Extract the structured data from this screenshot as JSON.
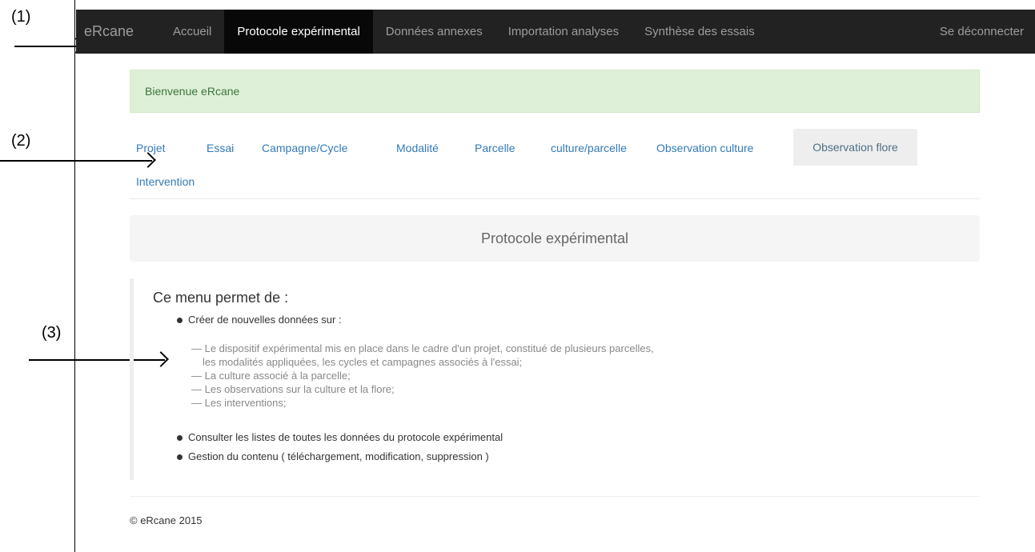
{
  "annotations": {
    "label_1": "(1)",
    "label_2": "(2)",
    "label_3": "(3)"
  },
  "navbar": {
    "brand": "eRcane",
    "items": [
      {
        "label": "Accueil",
        "active": false
      },
      {
        "label": "Protocole expérimental",
        "active": true
      },
      {
        "label": "Données annexes",
        "active": false
      },
      {
        "label": "Importation analyses",
        "active": false
      },
      {
        "label": "Synthèse des essais",
        "active": false
      }
    ],
    "logout": "Se déconnecter"
  },
  "alert": {
    "text": "Bienvenue eRcane"
  },
  "tabs": [
    {
      "label": "Projet"
    },
    {
      "label": "Essai"
    },
    {
      "label": "Campagne/Cycle"
    },
    {
      "label": "Modalité"
    },
    {
      "label": "Parcelle"
    },
    {
      "label": "culture/parcelle"
    },
    {
      "label": "Observation culture"
    },
    {
      "label": "Observation flore",
      "active": true
    },
    {
      "label": "Intervention"
    }
  ],
  "main": {
    "title": "Protocole expérimental",
    "menu_title": "Ce menu permet de :",
    "item_1": "Créer de nouvelles données sur :",
    "sub_1a": "— Le dispositif expérimental mis en place dans le cadre d'un projet, constitué de plusieurs parcelles,",
    "sub_1b": "les modalités appliquées, les cycles et campagnes associés à l'essai;",
    "sub_2": "— La culture associé à la parcelle;",
    "sub_3": "— Les observations sur la culture et la flore;",
    "sub_4": "— Les interventions;",
    "item_2": "Consulter les listes de toutes les données du protocole expérimental",
    "item_3": "Gestion du contenu ( téléchargement, modification, suppression )"
  },
  "footer": {
    "text": "© eRcane 2015"
  },
  "colors": {
    "navbar_bg": "#222222",
    "navbar_active_bg": "#080808",
    "link": "#337ab7",
    "alert_bg": "#dff0d8",
    "alert_text": "#3c763d"
  }
}
